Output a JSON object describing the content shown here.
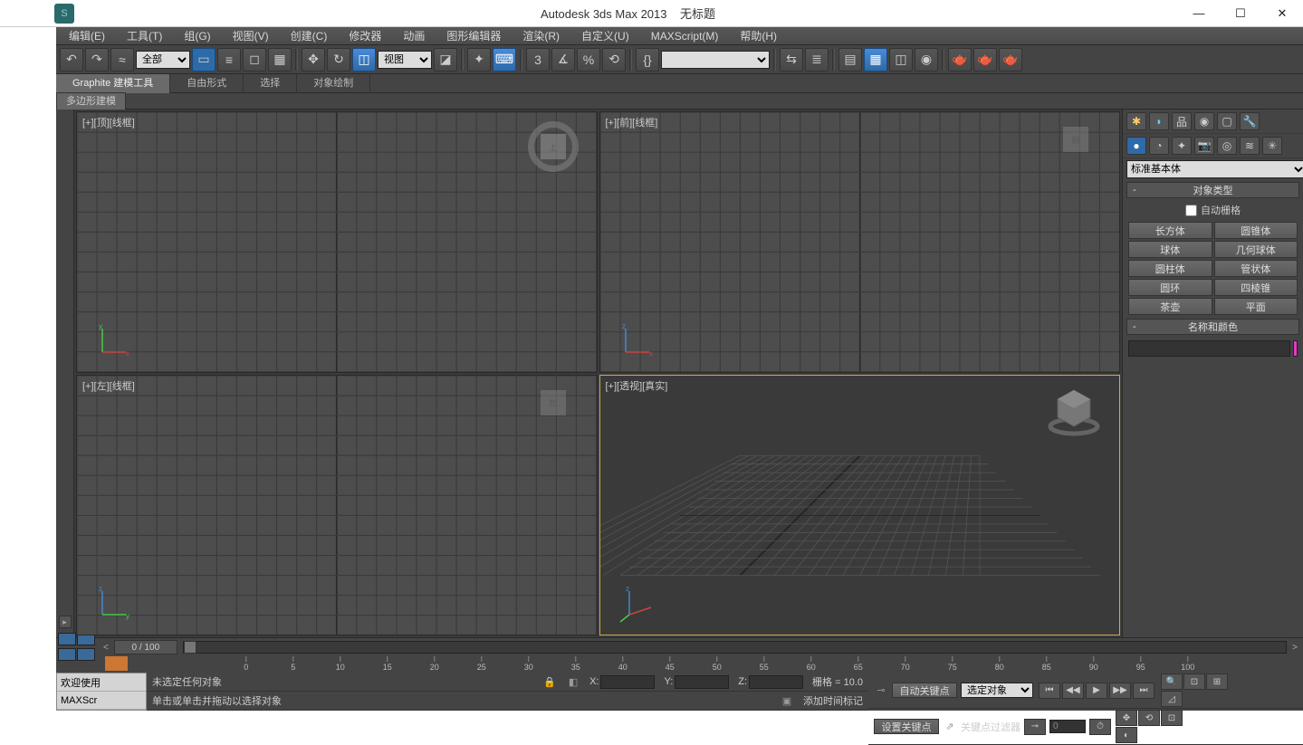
{
  "title": {
    "app": "Autodesk 3ds Max  2013",
    "doc": "无标题"
  },
  "menus": [
    "编辑(E)",
    "工具(T)",
    "组(G)",
    "视图(V)",
    "创建(C)",
    "修改器",
    "动画",
    "图形编辑器",
    "渲染(R)",
    "自定义(U)",
    "MAXScript(M)",
    "帮助(H)"
  ],
  "toolbar": {
    "filter": "全部",
    "coordsys": "视图",
    "snap_angle": "3",
    "snap_pct": "%"
  },
  "ribbon": {
    "tabs": [
      "Graphite 建模工具",
      "自由形式",
      "选择",
      "对象绘制"
    ],
    "sub": "多边形建模"
  },
  "viewports": {
    "top": "[+][顶][线框]",
    "front": "[+][前][线框]",
    "left": "[+][左][线框]",
    "persp": "[+][透视][真实]"
  },
  "panel": {
    "dropdown": "标准基本体",
    "roll_objtype": "对象类型",
    "autogrid": "自动栅格",
    "objects": [
      "长方体",
      "圆锥体",
      "球体",
      "几何球体",
      "圆柱体",
      "管状体",
      "圆环",
      "四棱锥",
      "茶壶",
      "平面"
    ],
    "roll_name": "名称和颜色"
  },
  "timeline": {
    "frame": "0 / 100",
    "ticks": [
      0,
      5,
      10,
      15,
      20,
      25,
      30,
      35,
      40,
      45,
      50,
      55,
      60,
      65,
      70,
      75,
      80,
      85,
      90,
      95,
      100
    ]
  },
  "status": {
    "welcome": "欢迎使用",
    "script": "MAXScr",
    "sel": "未选定任何对象",
    "hint": "单击或单击并拖动以选择对象",
    "x": "X:",
    "y": "Y:",
    "z": "Z:",
    "grid": "栅格 = 10.0",
    "marker": "添加时间标记",
    "autokey": "自动关键点",
    "setkey": "设置关键点",
    "selobj": "选定对象",
    "keyfilter": "关键点过滤器",
    "spin": "0"
  }
}
